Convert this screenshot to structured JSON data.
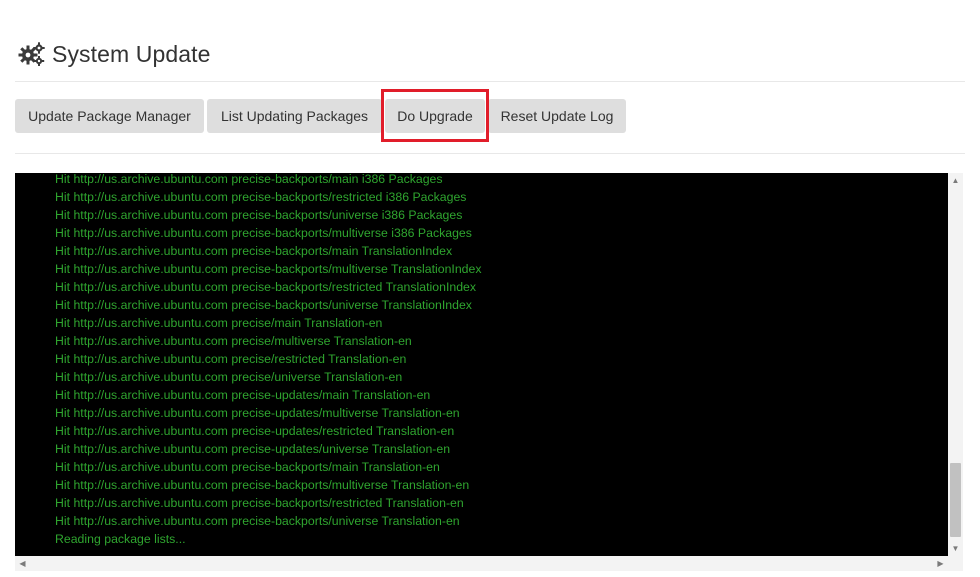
{
  "header": {
    "title": "System Update",
    "icon": "gears-icon"
  },
  "toolbar": {
    "update_package_manager": "Update Package Manager",
    "list_updating_packages": "List Updating Packages",
    "do_upgrade": "Do Upgrade",
    "reset_update_log": "Reset Update Log"
  },
  "console": {
    "text_color": "#2fa52f",
    "background": "#000000",
    "lines": [
      "Hit http://us.archive.ubuntu.com precise-backports/main i386 Packages",
      "Hit http://us.archive.ubuntu.com precise-backports/restricted i386 Packages",
      "Hit http://us.archive.ubuntu.com precise-backports/universe i386 Packages",
      "Hit http://us.archive.ubuntu.com precise-backports/multiverse i386 Packages",
      "Hit http://us.archive.ubuntu.com precise-backports/main TranslationIndex",
      "Hit http://us.archive.ubuntu.com precise-backports/multiverse TranslationIndex",
      "Hit http://us.archive.ubuntu.com precise-backports/restricted TranslationIndex",
      "Hit http://us.archive.ubuntu.com precise-backports/universe TranslationIndex",
      "Hit http://us.archive.ubuntu.com precise/main Translation-en",
      "Hit http://us.archive.ubuntu.com precise/multiverse Translation-en",
      "Hit http://us.archive.ubuntu.com precise/restricted Translation-en",
      "Hit http://us.archive.ubuntu.com precise/universe Translation-en",
      "Hit http://us.archive.ubuntu.com precise-updates/main Translation-en",
      "Hit http://us.archive.ubuntu.com precise-updates/multiverse Translation-en",
      "Hit http://us.archive.ubuntu.com precise-updates/restricted Translation-en",
      "Hit http://us.archive.ubuntu.com precise-updates/universe Translation-en",
      "Hit http://us.archive.ubuntu.com precise-backports/main Translation-en",
      "Hit http://us.archive.ubuntu.com precise-backports/multiverse Translation-en",
      "Hit http://us.archive.ubuntu.com precise-backports/restricted Translation-en",
      "Hit http://us.archive.ubuntu.com precise-backports/universe Translation-en",
      "Reading package lists..."
    ]
  },
  "highlight": {
    "target": "do-upgrade-button",
    "color": "#e11d2a"
  }
}
